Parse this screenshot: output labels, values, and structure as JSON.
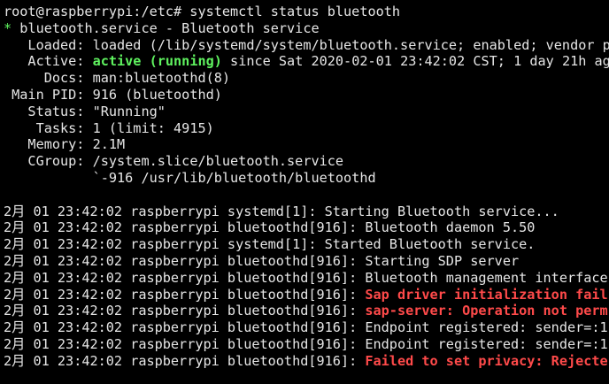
{
  "colors": {
    "background": "#000000",
    "foreground": "#e6e6e6",
    "ok_green": "#5ff25f",
    "error_red": "#ff4a4a"
  },
  "terminal": {
    "prompt": "root@raspberrypi:/etc# systemctl status bluetooth",
    "unit_bullet": "*",
    "unit_title": " bluetooth.service - Bluetooth service",
    "loaded_label": "   Loaded: ",
    "loaded_value": "loaded (/lib/systemd/system/bluetooth.service; enabled; vendor p",
    "active_label": "   Active: ",
    "active_state": "active (running)",
    "active_since": " since Sat 2020-02-01 23:42:02 CST; 1 day 21h ag",
    "docs_label": "     Docs: ",
    "docs_value": "man:bluetoothd(8)",
    "pid_label": " Main PID: ",
    "pid_value": "916 (bluetoothd)",
    "status_label": "   Status: ",
    "status_value": "\"Running\"",
    "tasks_label": "    Tasks: ",
    "tasks_value": "1 (limit: 4915)",
    "memory_label": "   Memory: ",
    "memory_value": "2.1M",
    "cgroup_label": "   CGroup: ",
    "cgroup_value": "/system.slice/bluetooth.service",
    "cgroup_child": "           `-916 /usr/lib/bluetooth/bluetoothd",
    "log": [
      {
        "prefix": "2月 01 23:42:02 raspberrypi systemd[1]: ",
        "message": "Starting Bluetooth service...",
        "error": false
      },
      {
        "prefix": "2月 01 23:42:02 raspberrypi bluetoothd[916]: ",
        "message": "Bluetooth daemon 5.50",
        "error": false
      },
      {
        "prefix": "2月 01 23:42:02 raspberrypi systemd[1]: ",
        "message": "Started Bluetooth service.",
        "error": false
      },
      {
        "prefix": "2月 01 23:42:02 raspberrypi bluetoothd[916]: ",
        "message": "Starting SDP server",
        "error": false
      },
      {
        "prefix": "2月 01 23:42:02 raspberrypi bluetoothd[916]: ",
        "message": "Bluetooth management interface",
        "error": false
      },
      {
        "prefix": "2月 01 23:42:02 raspberrypi bluetoothd[916]: ",
        "message": "Sap driver initialization fail",
        "error": true
      },
      {
        "prefix": "2月 01 23:42:02 raspberrypi bluetoothd[916]: ",
        "message": "sap-server: Operation not perm",
        "error": true
      },
      {
        "prefix": "2月 01 23:42:02 raspberrypi bluetoothd[916]: ",
        "message": "Endpoint registered: sender=:1",
        "error": false
      },
      {
        "prefix": "2月 01 23:42:02 raspberrypi bluetoothd[916]: ",
        "message": "Endpoint registered: sender=:1",
        "error": false
      },
      {
        "prefix": "2月 01 23:42:02 raspberrypi bluetoothd[916]: ",
        "message": "Failed to set privacy: Rejecte",
        "error": true
      }
    ]
  }
}
